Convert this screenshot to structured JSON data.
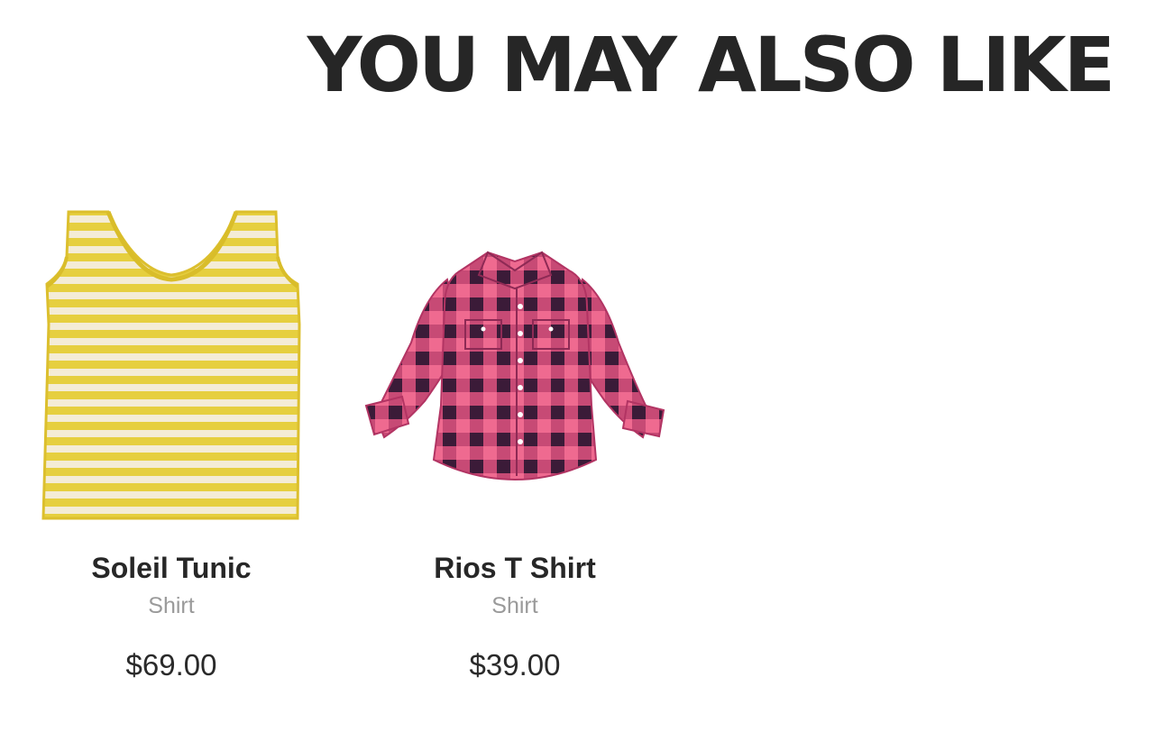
{
  "section": {
    "heading": "YOU MAY ALSO LIKE"
  },
  "products": [
    {
      "name": "Soleil Tunic",
      "category": "Shirt",
      "price": "$69.00",
      "image_icon": "yellow-striped-tank-top-image",
      "colors": {
        "primary": "#e6cf3f",
        "secondary": "#f3ecd7"
      }
    },
    {
      "name": "Rios T Shirt",
      "category": "Shirt",
      "price": "$39.00",
      "image_icon": "pink-plaid-shirt-image",
      "colors": {
        "primary": "#ec5b86",
        "secondary": "#3f1f3c"
      }
    }
  ]
}
